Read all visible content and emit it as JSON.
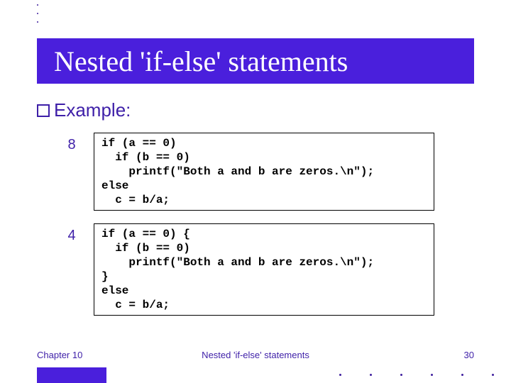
{
  "title": "Nested 'if-else' statements",
  "bullets": {
    "example_label": "Example:"
  },
  "code_rows": {
    "row1_bullet": "8",
    "row2_bullet": "4",
    "code1": "if (a == 0)\n  if (b == 0)\n    printf(\"Both a and b are zeros.\\n\");\nelse\n  c = b/a;",
    "code2": "if (a == 0) {\n  if (b == 0)\n    printf(\"Both a and b are zeros.\\n\");\n}\nelse\n  c = b/a;"
  },
  "footer": {
    "left": "Chapter 10",
    "center": "Nested 'if-else' statements",
    "right": "30"
  }
}
